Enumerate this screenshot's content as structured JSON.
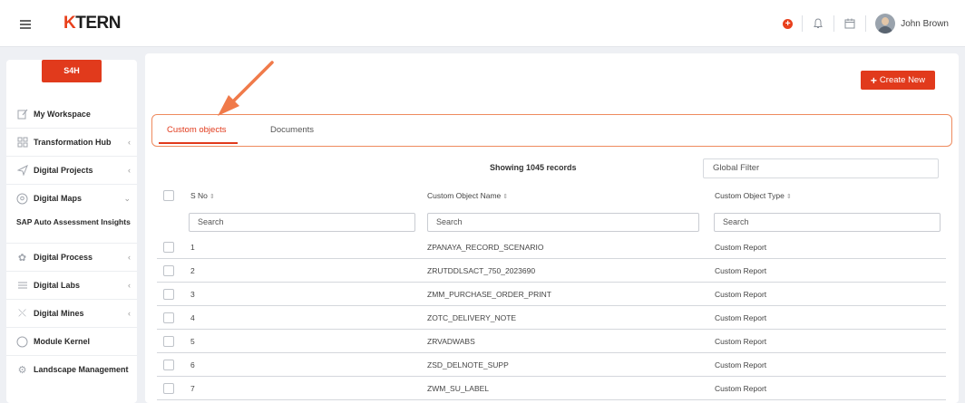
{
  "header": {
    "logo_k": "K",
    "logo_rest": "TERN",
    "user_name": "John Brown"
  },
  "sidebar": {
    "badge": "S4H",
    "items": [
      {
        "label": "My Workspace",
        "icon": "workspace-icon",
        "chevron": false
      },
      {
        "label": "Transformation Hub",
        "icon": "grid-icon",
        "chevron": true
      },
      {
        "label": "Digital Projects",
        "icon": "send-icon",
        "chevron": true
      },
      {
        "label": "Digital Maps",
        "icon": "map-icon",
        "chevron": true
      },
      {
        "label": "SAP Auto Assessment Insights",
        "sub": true
      },
      {
        "label": "Digital Process",
        "icon": "sun-icon",
        "chevron": true
      },
      {
        "label": "Digital Labs",
        "icon": "list-icon",
        "chevron": true
      },
      {
        "label": "Digital Mines",
        "icon": "shuffle-icon",
        "chevron": true
      },
      {
        "label": "Module Kernel",
        "icon": "circle-icon",
        "chevron": false
      },
      {
        "label": "Landscape Management",
        "icon": "gear-icon",
        "chevron": false
      }
    ]
  },
  "main": {
    "create_button": "Create New",
    "tabs": [
      {
        "label": "Custom objects",
        "active": true
      },
      {
        "label": "Documents",
        "active": false
      }
    ],
    "showing": "Showing 1045 records",
    "global_filter_placeholder": "Global Filter",
    "columns": [
      "S No",
      "Custom Object Name",
      "Custom Object Type"
    ],
    "search_placeholder": "Search",
    "rows": [
      {
        "sno": "1",
        "name": "ZPANAYA_RECORD_SCENARIO",
        "type": "Custom Report"
      },
      {
        "sno": "2",
        "name": "ZRUTDDLSACT_750_2023690",
        "type": "Custom Report"
      },
      {
        "sno": "3",
        "name": "ZMM_PURCHASE_ORDER_PRINT",
        "type": "Custom Report"
      },
      {
        "sno": "4",
        "name": "ZOTC_DELIVERY_NOTE",
        "type": "Custom Report"
      },
      {
        "sno": "5",
        "name": "ZRVADWABS",
        "type": "Custom Report"
      },
      {
        "sno": "6",
        "name": "ZSD_DELNOTE_SUPP",
        "type": "Custom Report"
      },
      {
        "sno": "7",
        "name": "ZWM_SU_LABEL",
        "type": "Custom Report"
      }
    ]
  },
  "colors": {
    "accent": "#e13a1c",
    "highlight_border": "#ee8a5e"
  }
}
